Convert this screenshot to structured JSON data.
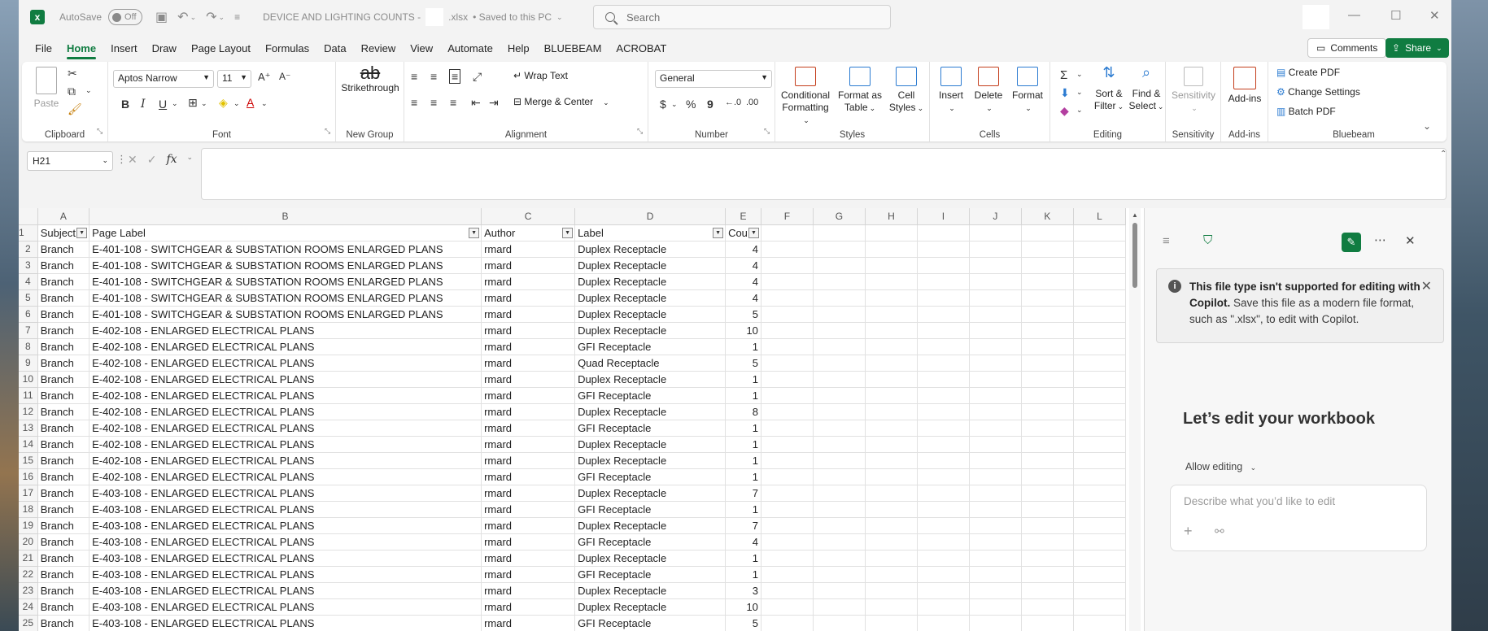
{
  "title_bar": {
    "autosave_label": "AutoSave",
    "autosave_state": "Off",
    "doc_name": "DEVICE AND LIGHTING COUNTS - ",
    "doc_ext": ".xlsx",
    "saved_status": "•  Saved to this PC",
    "search_placeholder": "Search"
  },
  "menu": {
    "tabs": [
      "File",
      "Home",
      "Insert",
      "Draw",
      "Page Layout",
      "Formulas",
      "Data",
      "Review",
      "View",
      "Automate",
      "Help",
      "BLUEBEAM",
      "ACROBAT"
    ],
    "active": "Home",
    "comments_label": "Comments",
    "share_label": "Share"
  },
  "ribbon": {
    "clipboard": {
      "label": "Clipboard",
      "paste": "Paste"
    },
    "font": {
      "label": "Font",
      "family": "Aptos Narrow",
      "size": "11",
      "bold": "B",
      "italic": "I",
      "underline": "U"
    },
    "new_group": {
      "label": "New Group",
      "strikethrough": "Strikethrough"
    },
    "alignment": {
      "label": "Alignment",
      "wrap_text": "Wrap Text",
      "merge_center": "Merge & Center"
    },
    "number": {
      "label": "Number",
      "format": "General",
      "currency": "$",
      "percent": "%",
      "comma": "9"
    },
    "styles": {
      "label": "Styles",
      "conditional_1": "Conditional",
      "conditional_2": "Formatting",
      "format_table_1": "Format as",
      "format_table_2": "Table",
      "cell_styles_1": "Cell",
      "cell_styles_2": "Styles"
    },
    "cells": {
      "label": "Cells",
      "insert": "Insert",
      "delete": "Delete",
      "format": "Format"
    },
    "editing": {
      "label": "Editing",
      "sort_1": "Sort &",
      "sort_2": "Filter",
      "find_1": "Find &",
      "find_2": "Select"
    },
    "sensitivity": {
      "label": "Sensitivity",
      "button": "Sensitivity"
    },
    "addins": {
      "label": "Add-ins",
      "button": "Add-ins"
    },
    "bluebeam": {
      "label": "Bluebeam",
      "create_pdf": "Create PDF",
      "change_settings": "Change Settings",
      "batch_pdf": "Batch PDF"
    }
  },
  "formula_bar": {
    "name_box": "H21",
    "fx": "fx",
    "content": ""
  },
  "sheet": {
    "columns": [
      "A",
      "B",
      "C",
      "D",
      "E",
      "F",
      "G",
      "H",
      "I",
      "J",
      "K",
      "L"
    ],
    "header_row": [
      "Subject",
      "Page Label",
      "Author",
      "Label",
      "Cou"
    ],
    "rows": [
      [
        "Branch",
        "E-401-108 - SWITCHGEAR & SUBSTATION ROOMS ENLARGED PLANS",
        "rmard",
        "Duplex Receptacle",
        "4"
      ],
      [
        "Branch",
        "E-401-108 - SWITCHGEAR & SUBSTATION ROOMS ENLARGED PLANS",
        "rmard",
        "Duplex Receptacle",
        "4"
      ],
      [
        "Branch",
        "E-401-108 - SWITCHGEAR & SUBSTATION ROOMS ENLARGED PLANS",
        "rmard",
        "Duplex Receptacle",
        "4"
      ],
      [
        "Branch",
        "E-401-108 - SWITCHGEAR & SUBSTATION ROOMS ENLARGED PLANS",
        "rmard",
        "Duplex Receptacle",
        "4"
      ],
      [
        "Branch",
        "E-401-108 - SWITCHGEAR & SUBSTATION ROOMS ENLARGED PLANS",
        "rmard",
        "Duplex Receptacle",
        "5"
      ],
      [
        "Branch",
        "E-402-108 - ENLARGED ELECTRICAL PLANS",
        "rmard",
        "Duplex Receptacle",
        "10"
      ],
      [
        "Branch",
        "E-402-108 - ENLARGED ELECTRICAL PLANS",
        "rmard",
        "GFI Receptacle",
        "1"
      ],
      [
        "Branch",
        "E-402-108 - ENLARGED ELECTRICAL PLANS",
        "rmard",
        "Quad Receptacle",
        "5"
      ],
      [
        "Branch",
        "E-402-108 - ENLARGED ELECTRICAL PLANS",
        "rmard",
        "Duplex Receptacle",
        "1"
      ],
      [
        "Branch",
        "E-402-108 - ENLARGED ELECTRICAL PLANS",
        "rmard",
        "GFI Receptacle",
        "1"
      ],
      [
        "Branch",
        "E-402-108 - ENLARGED ELECTRICAL PLANS",
        "rmard",
        "Duplex Receptacle",
        "8"
      ],
      [
        "Branch",
        "E-402-108 - ENLARGED ELECTRICAL PLANS",
        "rmard",
        "GFI Receptacle",
        "1"
      ],
      [
        "Branch",
        "E-402-108 - ENLARGED ELECTRICAL PLANS",
        "rmard",
        "Duplex Receptacle",
        "1"
      ],
      [
        "Branch",
        "E-402-108 - ENLARGED ELECTRICAL PLANS",
        "rmard",
        "Duplex Receptacle",
        "1"
      ],
      [
        "Branch",
        "E-402-108 - ENLARGED ELECTRICAL PLANS",
        "rmard",
        "GFI Receptacle",
        "1"
      ],
      [
        "Branch",
        "E-403-108 - ENLARGED ELECTRICAL PLANS",
        "rmard",
        "Duplex Receptacle",
        "7"
      ],
      [
        "Branch",
        "E-403-108 - ENLARGED ELECTRICAL PLANS",
        "rmard",
        "GFI Receptacle",
        "1"
      ],
      [
        "Branch",
        "E-403-108 - ENLARGED ELECTRICAL PLANS",
        "rmard",
        "Duplex Receptacle",
        "7"
      ],
      [
        "Branch",
        "E-403-108 - ENLARGED ELECTRICAL PLANS",
        "rmard",
        "GFI Receptacle",
        "4"
      ],
      [
        "Branch",
        "E-403-108 - ENLARGED ELECTRICAL PLANS",
        "rmard",
        "Duplex Receptacle",
        "1"
      ],
      [
        "Branch",
        "E-403-108 - ENLARGED ELECTRICAL PLANS",
        "rmard",
        "GFI Receptacle",
        "1"
      ],
      [
        "Branch",
        "E-403-108 - ENLARGED ELECTRICAL PLANS",
        "rmard",
        "Duplex Receptacle",
        "3"
      ],
      [
        "Branch",
        "E-403-108 - ENLARGED ELECTRICAL PLANS",
        "rmard",
        "Duplex Receptacle",
        "10"
      ],
      [
        "Branch",
        "E-403-108 - ENLARGED ELECTRICAL PLANS",
        "rmard",
        "GFI Receptacle",
        "5"
      ]
    ]
  },
  "copilot": {
    "notice_bold": "This file type isn't supported for editing with Copilot.",
    "notice_text": " Save this file as a modern file format, such as \".xlsx\", to edit with Copilot.",
    "heading": "Let’s edit your workbook",
    "allow_editing": "Allow editing",
    "prompt_placeholder": "Describe what you’d like to edit"
  },
  "colors": {
    "accent": "#107c41",
    "ribbon_bg": "#ffffff",
    "chrome_bg": "#f3f3f3"
  }
}
